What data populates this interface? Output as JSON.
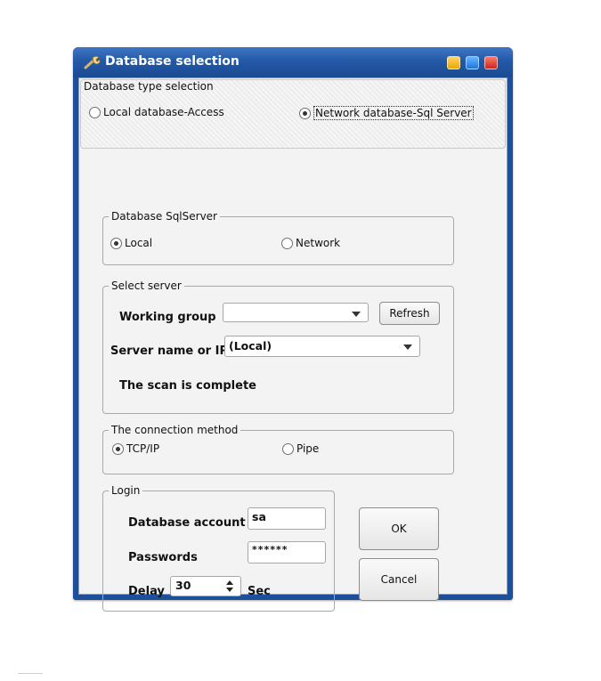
{
  "window": {
    "title": "Database selection",
    "icon": "wrench-tool-icon",
    "buttons": [
      "minimize-button",
      "maximize-button",
      "close-button"
    ]
  },
  "db_type": {
    "legend": "Database type selection",
    "options": [
      {
        "label": "Local database-Access",
        "selected": false
      },
      {
        "label": "Network database-Sql Server",
        "selected": true
      }
    ]
  },
  "sqlserver": {
    "legend": "Database SqlServer",
    "options": [
      {
        "label": "Local",
        "selected": true
      },
      {
        "label": "Network",
        "selected": false
      }
    ]
  },
  "select_server": {
    "legend": "Select server",
    "working_group_label": "Working group",
    "working_group_value": "",
    "refresh_label": "Refresh",
    "server_label": "Server name or IP",
    "server_value": "(Local)",
    "status": "The scan is complete"
  },
  "connection": {
    "legend": "The connection method",
    "options": [
      {
        "label": "TCP/IP",
        "selected": true
      },
      {
        "label": "Pipe",
        "selected": false
      }
    ]
  },
  "login": {
    "legend": "Login",
    "account_label": "Database account",
    "account_value": "sa",
    "password_label": "Passwords",
    "password_value": "******",
    "delay_label": "Delay",
    "delay_value": "30",
    "delay_unit": "Sec"
  },
  "actions": {
    "ok": "OK",
    "cancel": "Cancel"
  }
}
